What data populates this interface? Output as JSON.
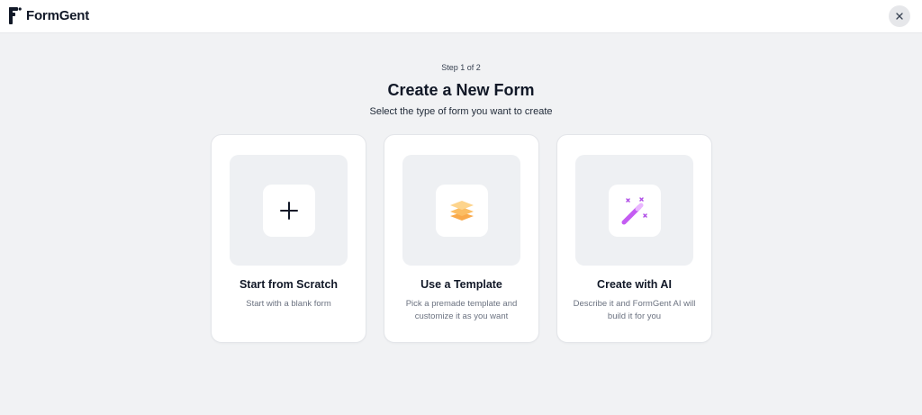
{
  "app": {
    "name": "FormGent"
  },
  "header": {
    "step": "Step 1 of 2",
    "title": "Create a New Form",
    "subtitle": "Select the type of form you want to create"
  },
  "options": [
    {
      "title": "Start from Scratch",
      "description": "Start with a blank form",
      "icon": "plus-icon"
    },
    {
      "title": "Use a Template",
      "description": "Pick a premade template and customize it as you want",
      "icon": "layers-icon"
    },
    {
      "title": "Create with AI",
      "description": "Describe it and FormGent AI will build it for you",
      "icon": "magic-wand-icon"
    }
  ],
  "colors": {
    "background": "#f1f2f4",
    "template_icon": "#f9a94b",
    "ai_icon": "#c45cf2"
  }
}
